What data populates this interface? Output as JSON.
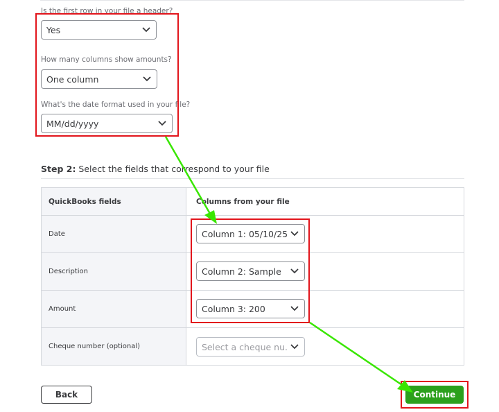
{
  "step1": {
    "header_question": "Is the first row in your file a header?",
    "header_value": "Yes",
    "amount_columns_question": "How many columns show amounts?",
    "amount_columns_value": "One column",
    "date_format_question": "What's the date format used in your file?",
    "date_format_value": "MM/dd/yyyy"
  },
  "step2": {
    "title_bold": "Step 2:",
    "title_rest": " Select the fields that correspond to your file",
    "table": {
      "col_quickbooks": "QuickBooks fields",
      "col_file": "Columns from your file",
      "rows": [
        {
          "field": "Date",
          "mapping": "Column 1: 05/10/25"
        },
        {
          "field": "Description",
          "mapping": "Column 2: Sample"
        },
        {
          "field": "Amount",
          "mapping": "Column 3: 200"
        },
        {
          "field": "Cheque number (optional)",
          "mapping": "Select a cheque nu..."
        }
      ]
    }
  },
  "buttons": {
    "back": "Back",
    "continue": "Continue"
  },
  "colors": {
    "annotation_red": "#e2141b",
    "annotation_arrow_green": "#39e600",
    "continue_green": "#2ca01c"
  },
  "icons": {
    "dropdown": "chevron-down-icon"
  }
}
